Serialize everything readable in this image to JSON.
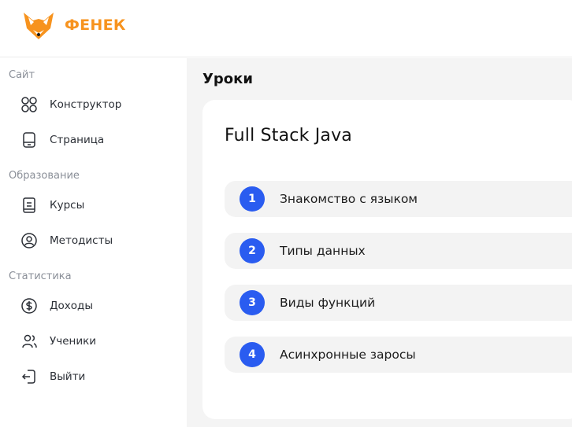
{
  "header": {
    "logo_text": "ФЕНЕК",
    "brand_color": "#f7931e"
  },
  "sidebar": {
    "sections": [
      {
        "title": "Сайт",
        "items": [
          {
            "label": "Конструктор",
            "icon": "grid-icon"
          },
          {
            "label": "Страница",
            "icon": "page-icon"
          }
        ]
      },
      {
        "title": "Образование",
        "items": [
          {
            "label": "Курсы",
            "icon": "book-icon"
          },
          {
            "label": "Методисты",
            "icon": "user-circle-icon"
          }
        ]
      },
      {
        "title": "Статистика",
        "items": [
          {
            "label": "Доходы",
            "icon": "dollar-icon"
          },
          {
            "label": "Ученики",
            "icon": "users-icon"
          },
          {
            "label": "Выйти",
            "icon": "logout-icon"
          }
        ]
      }
    ]
  },
  "main": {
    "title": "Уроки",
    "course_title": "Full Stack Java",
    "lessons": [
      {
        "num": "1",
        "title": "Знакомство с языком"
      },
      {
        "num": "2",
        "title": "Типы данных"
      },
      {
        "num": "3",
        "title": "Виды функций"
      },
      {
        "num": "4",
        "title": "Асинхронные заросы"
      }
    ],
    "accent_color": "#2a5cf0"
  }
}
